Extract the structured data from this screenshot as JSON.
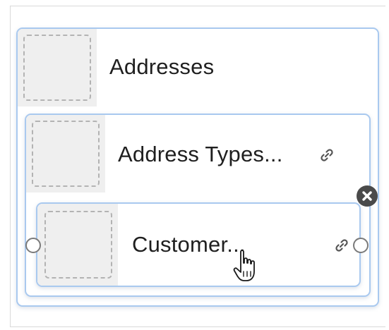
{
  "nodes": [
    {
      "label": "Addresses",
      "has_link": false
    },
    {
      "label": "Address Types...",
      "has_link": true
    },
    {
      "label": "Customer...",
      "has_link": true
    }
  ],
  "icons": {
    "link": "link-icon",
    "close": "close-icon",
    "cursor": "hand-pointer-cursor-icon"
  },
  "colors": {
    "card_border": "#a9c9ef",
    "thumbnail_bg": "#efefef",
    "close_button": "#4a4a4a"
  }
}
